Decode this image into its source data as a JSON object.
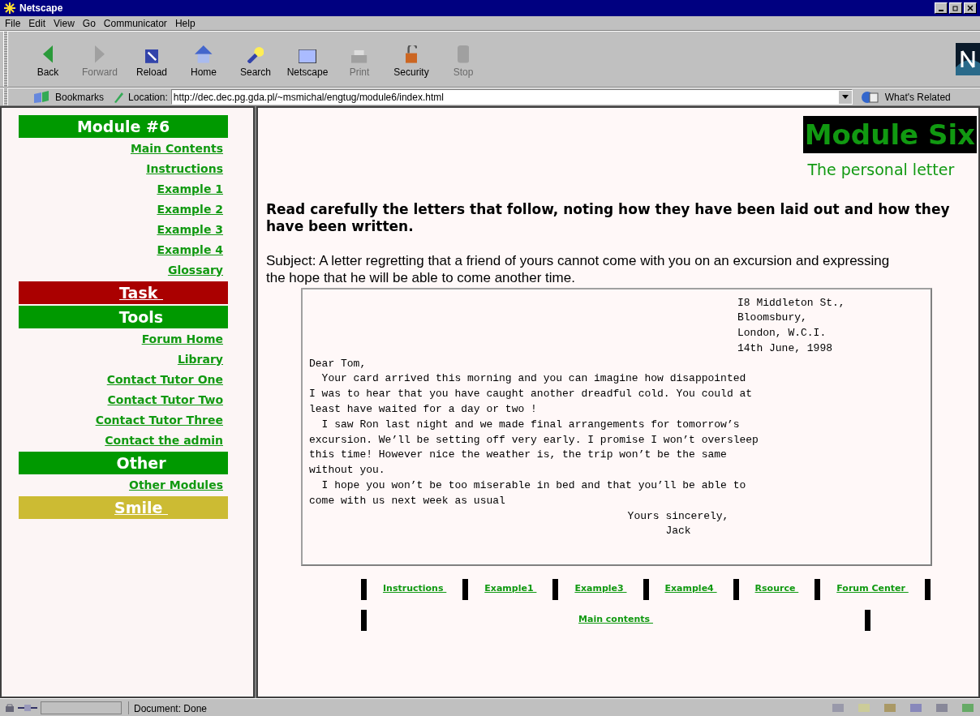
{
  "window": {
    "title": "Netscape"
  },
  "menu": [
    "File",
    "Edit",
    "View",
    "Go",
    "Communicator",
    "Help"
  ],
  "toolbar": [
    {
      "label": "Back",
      "disabled": false
    },
    {
      "label": "Forward",
      "disabled": true
    },
    {
      "label": "Reload",
      "disabled": false
    },
    {
      "label": "Home",
      "disabled": false
    },
    {
      "label": "Search",
      "disabled": false
    },
    {
      "label": "Netscape",
      "disabled": false
    },
    {
      "label": "Print",
      "disabled": true
    },
    {
      "label": "Security",
      "disabled": false
    },
    {
      "label": "Stop",
      "disabled": true
    }
  ],
  "location_bar": {
    "bookmarks": "Bookmarks",
    "label": "Location:",
    "value": "http://dec.dec.pg.gda.pl/~msmichal/engtug/module6/index.html",
    "related": "What's Related"
  },
  "sidebar": [
    {
      "kind": "header",
      "label": "Module #6",
      "color": "#009900"
    },
    {
      "kind": "link",
      "label": "Main Contents"
    },
    {
      "kind": "link",
      "label": "Instructions"
    },
    {
      "kind": "link",
      "label": "Example 1"
    },
    {
      "kind": "link",
      "label": "Example 2"
    },
    {
      "kind": "link",
      "label": "Example 3"
    },
    {
      "kind": "link",
      "label": "Example 4"
    },
    {
      "kind": "link",
      "label": "Glossary"
    },
    {
      "kind": "header_link",
      "label": "Task ",
      "color": "#aa0000"
    },
    {
      "kind": "header",
      "label": "Tools",
      "color": "#009900"
    },
    {
      "kind": "link",
      "label": "Forum Home"
    },
    {
      "kind": "link",
      "label": "Library"
    },
    {
      "kind": "link",
      "label": "Contact Tutor One"
    },
    {
      "kind": "link",
      "label": "Contact Tutor Two"
    },
    {
      "kind": "link",
      "label": "Contact Tutor Three"
    },
    {
      "kind": "link",
      "label": "Contact the admin"
    },
    {
      "kind": "header",
      "label": "Other",
      "color": "#009900"
    },
    {
      "kind": "link",
      "label": "Other Modules"
    },
    {
      "kind": "header_link",
      "label": "Smile ",
      "color": "#ccbb33"
    }
  ],
  "page": {
    "title": "Module Six",
    "subtitle": "The personal letter",
    "instruction": "Read carefully the letters that follow, noting how they have been laid out and how they have been written.",
    "subject": "Subject: A letter regretting that a friend of yours cannot come with you on an excursion and expressing the hope that he will be able to come another time.",
    "letter": {
      "address": [
        "I8 Middleton St.,",
        "Bloomsbury,",
        "London, W.C.I.",
        "14th June, 1998"
      ],
      "body": [
        "Dear Tom,",
        "  Your card arrived this morning and you can imagine how disappointed",
        "I was to hear that you have caught another dreadful cold. You could at",
        "least have waited for a day or two !",
        "  I saw Ron last night and we made final arrangements for tomorrow’s",
        "excursion. We’ll be setting off very early. I promise I won’t oversleep",
        "this time! However nice the weather is, the trip won’t be the same",
        "without you.",
        "  I hope you won’t be too miserable in bed and that you’ll be able to",
        "come with us next week as usual"
      ],
      "closing": [
        "Yours sincerely,",
        "Jack"
      ]
    },
    "nav": [
      "Instructions ",
      "Example1 ",
      "Example3 ",
      "Example4 ",
      "Rsource ",
      "Forum Center "
    ],
    "nav_bottom": "Main contents "
  },
  "status_bar": {
    "text": "Document: Done"
  }
}
